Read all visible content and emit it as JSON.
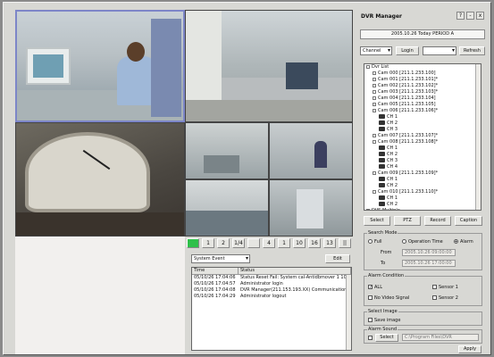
{
  "window_title": "DVR Manager",
  "toolbar": {
    "help_icon": "?",
    "minimize_icon": "-",
    "close_icon": "x"
  },
  "datetime": "2005.10.26 Today PERIOD A",
  "site_select": "Channel",
  "login_label": "Login",
  "refresh_label": "Refresh",
  "tree": {
    "items": [
      {
        "label": "Dvr List",
        "depth": 0
      },
      {
        "label": "Cam 000 [211.1.233.100]",
        "depth": 1
      },
      {
        "label": "Cam 001 [211.1.233.101]*",
        "depth": 1
      },
      {
        "label": "Cam 002 [211.1.233.102]*",
        "depth": 1
      },
      {
        "label": "Cam 003 [211.1.233.103]*",
        "depth": 1
      },
      {
        "label": "Cam 004 [211.1.233.104]",
        "depth": 1
      },
      {
        "label": "Cam 005 [211.1.233.105]",
        "depth": 1
      },
      {
        "label": "Cam 006 [211.1.233.106]*",
        "depth": 1
      },
      {
        "label": "CH 1",
        "depth": 2
      },
      {
        "label": "CH 2",
        "depth": 2
      },
      {
        "label": "CH 3",
        "depth": 2
      },
      {
        "label": "Cam 007 [211.1.233.107]*",
        "depth": 1
      },
      {
        "label": "Cam 008 [211.1.233.108]*",
        "depth": 1
      },
      {
        "label": "CH 1",
        "depth": 2
      },
      {
        "label": "CH 2",
        "depth": 2
      },
      {
        "label": "CH 3",
        "depth": 2
      },
      {
        "label": "CH 4",
        "depth": 2
      },
      {
        "label": "Cam 009 [211.1.233.109]*",
        "depth": 1
      },
      {
        "label": "CH 1",
        "depth": 2
      },
      {
        "label": "CH 2",
        "depth": 2
      },
      {
        "label": "Cam 010 [211.1.233.110]*",
        "depth": 1
      },
      {
        "label": "CH 1",
        "depth": 2
      },
      {
        "label": "CH 2",
        "depth": 2
      },
      {
        "label": "DVS Multiple",
        "depth": 0
      }
    ]
  },
  "actions": {
    "select": "Select",
    "ptz": "PTZ",
    "record": "Record",
    "caption": "Caption"
  },
  "search": {
    "title": "Search Mode",
    "opt_full": "Full",
    "opt_operation": "Operation Time",
    "opt_alarm": "Alarm",
    "from_label": "From",
    "to_label": "To",
    "from_value": "2005.10.26  09:00:00",
    "to_value": "2005.10.26  17:00:00"
  },
  "alarm": {
    "title": "Alarm Condition",
    "opt_all": "ALL",
    "opt_sensor1": "Sensor 1",
    "opt_novideo": "No Video Signal",
    "opt_sensor2": "Sensor 2"
  },
  "image": {
    "title": "Select Image",
    "opt_save": "Save image"
  },
  "alarm_sound": {
    "title": "Alarm Sound",
    "button": "Select",
    "field": "C:\\Program Files\\DVR"
  },
  "apply_label": "Apply",
  "log": {
    "select": "System Event",
    "button": "Edit",
    "headers": [
      "Time",
      "Status"
    ],
    "rows": [
      {
        "time": "05/10/26 17:04:06",
        "status": "Status Reset Fail: System cal-Antidbmover 1 10036"
      },
      {
        "time": "05/10/26 17:04:57",
        "status": "Administrator login"
      },
      {
        "time": "05/10/26 17:04:08",
        "status": "DVR Manager(211.153.193.XX) Communication Error"
      },
      {
        "time": "05/10/26 17:04:29",
        "status": "Administrator logout"
      }
    ]
  },
  "controls": [
    "",
    "1",
    "2",
    "1/4",
    "",
    "4",
    "1",
    "10",
    "16",
    "13",
    "||"
  ]
}
